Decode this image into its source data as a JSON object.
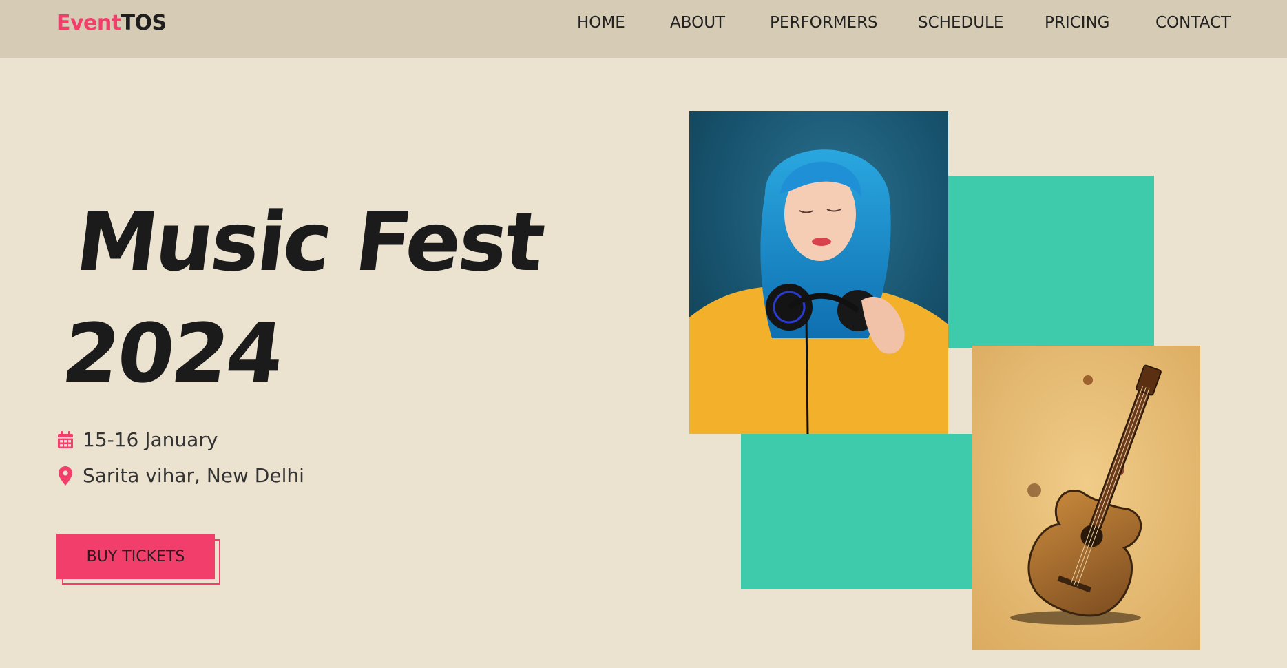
{
  "brand": {
    "part1": "Event",
    "part2": "TOS"
  },
  "nav": {
    "items": [
      "HOME",
      "ABOUT",
      "PERFORMERS",
      "SCHEDULE",
      "PRICING",
      "CONTACT"
    ]
  },
  "hero": {
    "title_line1": "Music Fest",
    "title_line2": "2024",
    "date": "15-16 January",
    "location": "Sarita vihar, New Delhi",
    "cta_label": "BUY TICKETS"
  },
  "images": {
    "performer_icon": "woman-with-headphones-photo",
    "guitar_icon": "acoustic-guitar-illustration"
  },
  "colors": {
    "accent": "#f23e6b",
    "teal": "#3ecbab",
    "background": "#ebe3d0",
    "navbar": "#d6cbb4"
  }
}
